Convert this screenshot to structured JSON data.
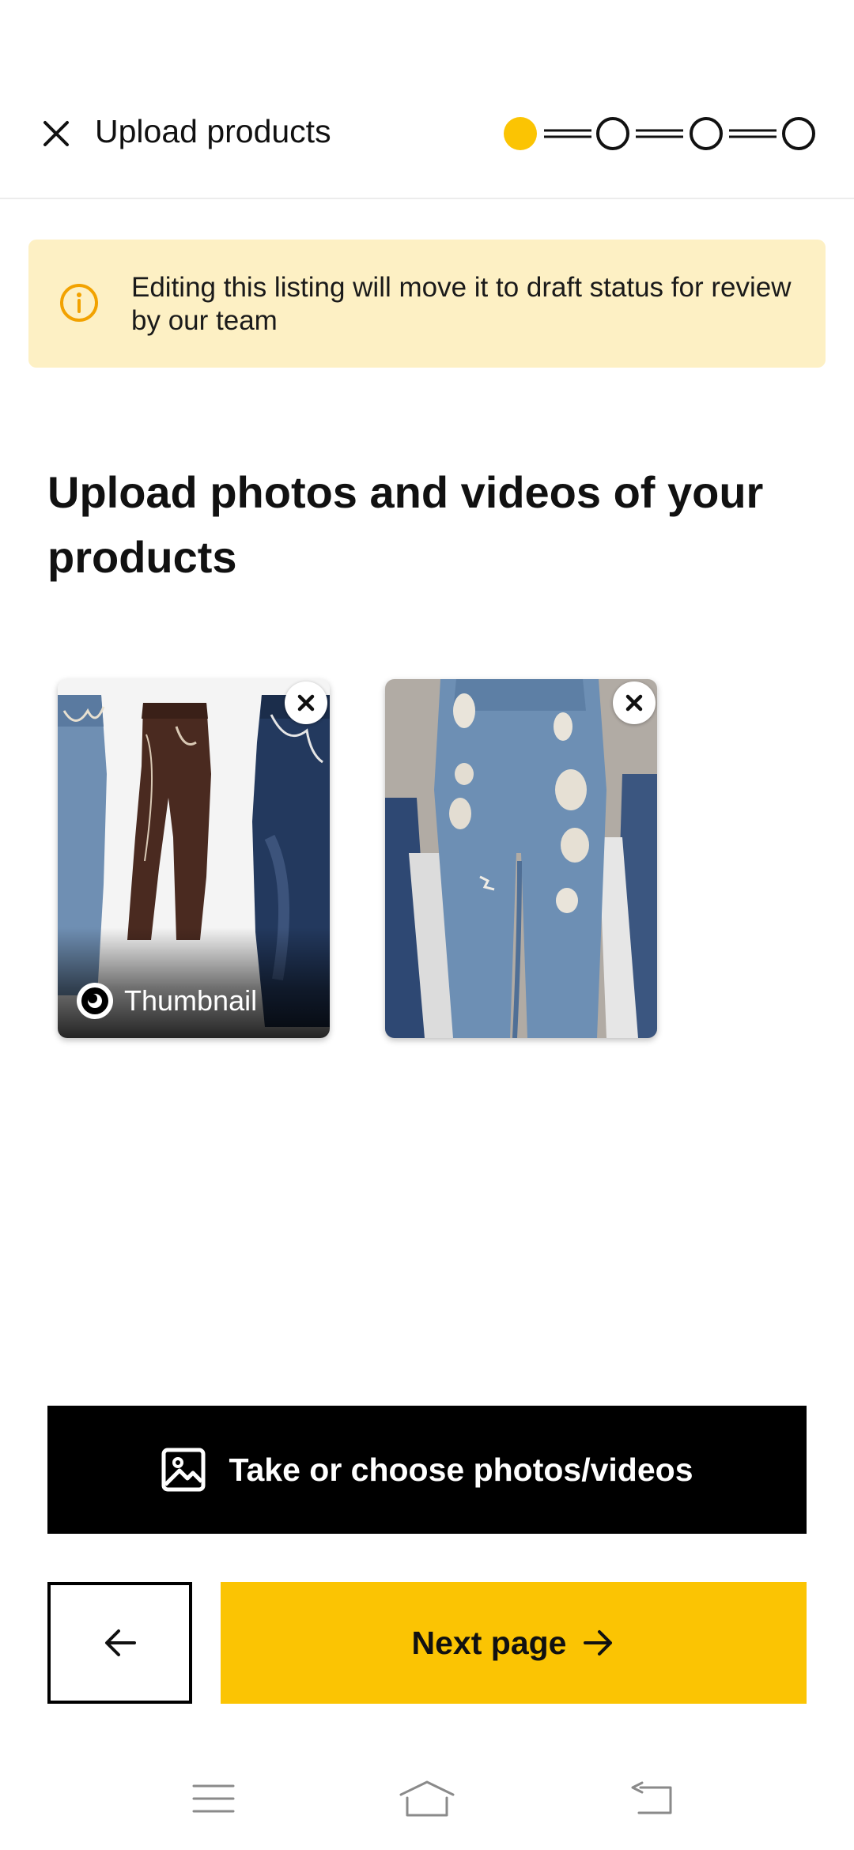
{
  "header": {
    "title": "Upload products",
    "close_icon": "close-icon",
    "stepper": {
      "total_steps": 4,
      "current_step": 1,
      "active_color": "#fbc403"
    }
  },
  "notice": {
    "icon": "info-icon",
    "text": "Editing this listing will move it to draft status for review by our team",
    "background": "#fdf0c4",
    "icon_color": "#f2a200"
  },
  "main": {
    "heading": "Upload photos and videos of your products",
    "photos": [
      {
        "id": "photo-1",
        "label": "Thumbnail",
        "is_thumbnail": true,
        "remove_icon": "close-circle-icon"
      },
      {
        "id": "photo-2",
        "is_thumbnail": false,
        "remove_icon": "close-circle-icon"
      }
    ]
  },
  "actions": {
    "take_photo_label": "Take or choose photos/videos",
    "take_photo_icon": "image-icon",
    "back_icon": "arrow-left-icon",
    "next_label": "Next page",
    "next_icon": "arrow-right-icon",
    "accent": "#fbc403"
  },
  "system_nav": {
    "menu_icon": "menu-icon",
    "home_icon": "home-icon",
    "back_icon": "back-icon"
  }
}
